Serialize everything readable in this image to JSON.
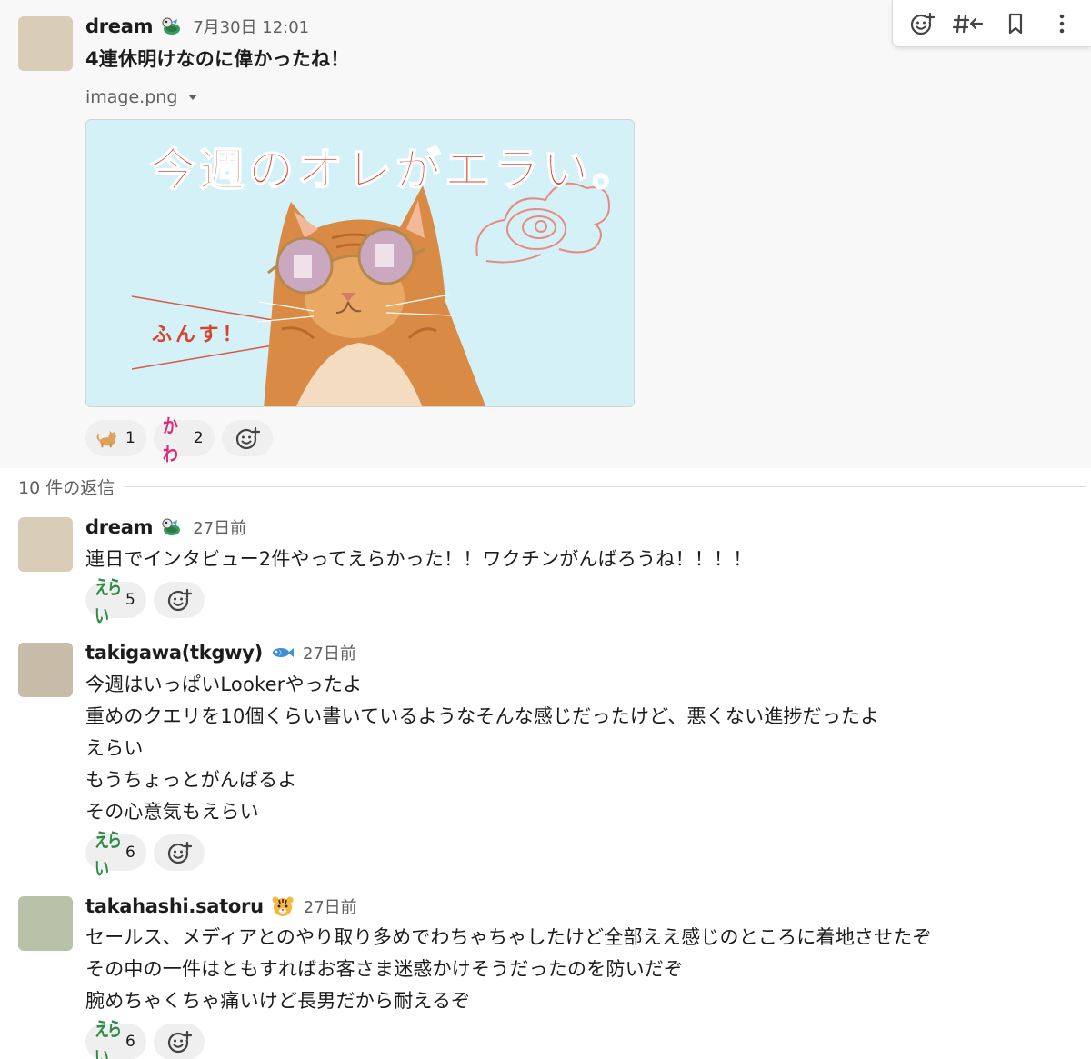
{
  "toolbar": {
    "add_reaction_icon": "emoji-add-icon",
    "reply_in_thread_icon": "hash-back-icon",
    "bookmark_icon": "bookmark-icon",
    "more_icon": "more-vertical-icon"
  },
  "parent_message": {
    "author": "dream",
    "status_emoji": "turtle-bird-icon",
    "time": "7月30日 12:01",
    "text": "4連休明けなのに偉かったね！",
    "attachment": {
      "filename": "image.png",
      "image_title": "今週のオレがエラい。",
      "image_caption": "ふんす！"
    },
    "reactions": [
      {
        "emoji": "cat-icon",
        "count": "1"
      },
      {
        "emoji": "kawa-icon",
        "label": "かわ",
        "count": "2"
      }
    ]
  },
  "thread": {
    "reply_count_label": "10 件の返信"
  },
  "replies": [
    {
      "author": "dream",
      "status_emoji": "turtle-bird-icon",
      "time": "27日前",
      "lines": [
        "連日でインタビュー2件やってえらかった！！ワクチンがんばろうね！！！！"
      ],
      "reaction": {
        "emoji": "erai-icon",
        "label": "えらい",
        "count": "5"
      }
    },
    {
      "author": "takigawa(tkgwy)",
      "status_emoji": "fish-icon",
      "time": "27日前",
      "lines": [
        "今週はいっぱいLookerやったよ",
        "重めのクエリを10個くらい書いているようなそんな感じだったけど、悪くない進捗だったよ",
        "えらい",
        "もうちょっとがんばるよ",
        "その心意気もえらい"
      ],
      "reaction": {
        "emoji": "erai-icon",
        "label": "えらい",
        "count": "6"
      }
    },
    {
      "author": "takahashi.satoru",
      "status_emoji": "tiger-icon",
      "time": "27日前",
      "lines": [
        "セールス、メディアとのやり取り多めでわちゃちゃしたけど全部ええ感じのところに着地させたぞ",
        "その中の一件はともすればお客さま迷惑かけそうだったのを防いだぞ",
        "腕めちゃくちゃ痛いけど長男だから耐えるぞ"
      ],
      "reaction": {
        "emoji": "erai-icon",
        "label": "えらい",
        "count": "6"
      }
    }
  ]
}
